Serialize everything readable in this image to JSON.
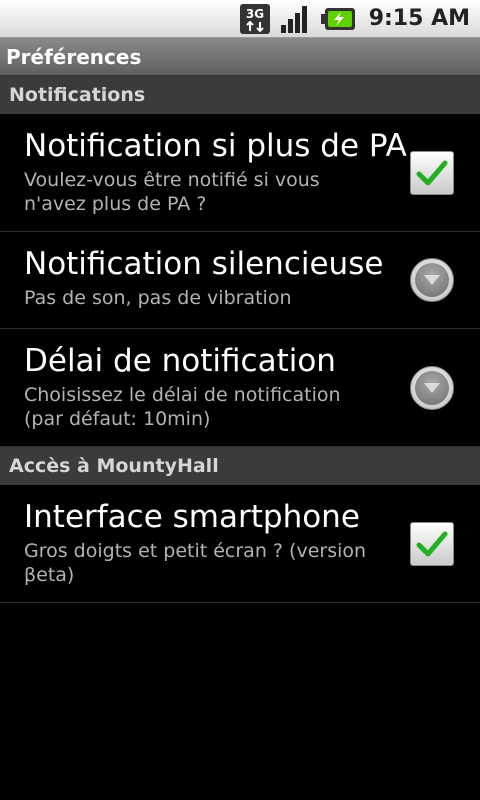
{
  "status_bar": {
    "network": "3G",
    "time": "9:15 AM",
    "icons": [
      "3g-data-icon",
      "signal-strength-icon",
      "battery-charging-icon"
    ]
  },
  "title": "Préférences",
  "categories": [
    {
      "label": "Notifications",
      "preferences": [
        {
          "title": "Notification si plus de PA",
          "summary": "Voulez-vous être notifié si vous n'avez plus de PA ?",
          "widget": "checkbox",
          "checked": true
        },
        {
          "title": "Notification silencieuse",
          "summary": "Pas de son, pas de vibration",
          "widget": "dropdown"
        },
        {
          "title": "Délai de notification",
          "summary": "Choisissez le délai de notification (par défaut: 10min)",
          "widget": "dropdown"
        }
      ]
    },
    {
      "label": "Accès à MountyHall",
      "preferences": [
        {
          "title": "Interface smartphone",
          "summary": "Gros doigts et petit écran ? (version βeta)",
          "widget": "checkbox",
          "checked": true
        }
      ]
    }
  ],
  "colors": {
    "background": "#000000",
    "category_bg": "#3b3b3b",
    "check_green": "#22b022",
    "summary_text": "#b3b3b3"
  }
}
